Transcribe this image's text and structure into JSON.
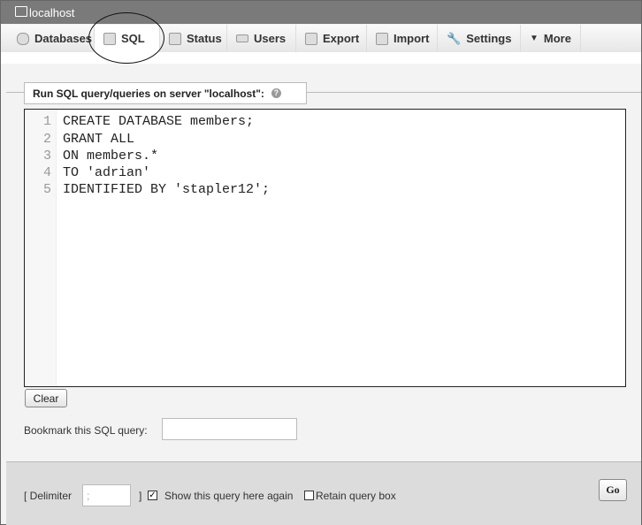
{
  "window": {
    "title": "localhost"
  },
  "tabs": [
    {
      "label": "Databases",
      "icon": "database-icon"
    },
    {
      "label": "SQL",
      "icon": "sql-icon"
    },
    {
      "label": "Status",
      "icon": "status-icon"
    },
    {
      "label": "Users",
      "icon": "users-icon"
    },
    {
      "label": "Export",
      "icon": "export-icon"
    },
    {
      "label": "Import",
      "icon": "import-icon"
    },
    {
      "label": "Settings",
      "icon": "wrench-icon"
    },
    {
      "label": "More",
      "icon": "triangle-down-icon"
    }
  ],
  "active_tab": "SQL",
  "query": {
    "legend": "Run SQL query/queries on server \"localhost\":",
    "lines": [
      "CREATE DATABASE members;",
      "GRANT ALL",
      "ON members.*",
      "TO 'adrian'",
      "IDENTIFIED BY 'stapler12';"
    ],
    "line_numbers": [
      "1",
      "2",
      "3",
      "4",
      "5"
    ]
  },
  "clear_label": "Clear",
  "bookmark_label": "Bookmark this SQL query:",
  "bookmark_value": "",
  "footer": {
    "delimiter_open": "[ Delimiter",
    "delimiter_value": ";",
    "delimiter_close": "]",
    "show_again_label": "Show this query here again",
    "show_again_checked": true,
    "retain_label": "Retain query box",
    "retain_checked": false,
    "go_label": "Go"
  }
}
